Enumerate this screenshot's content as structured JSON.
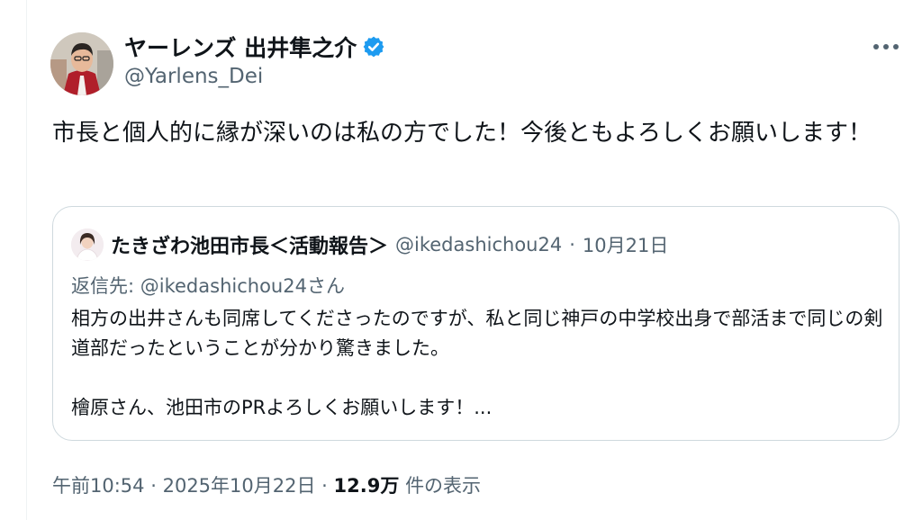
{
  "author": {
    "name": "ヤーレンズ 出井隼之介",
    "handle": "@Yarlens_Dei"
  },
  "tweet": {
    "text": "市長と個人的に縁が深いのは私の方でした！今後ともよろしくお願いします！"
  },
  "quote": {
    "author_name": "たきざわ池田市長＜活動報告＞",
    "handle": "@ikedashichou24",
    "separator": "·",
    "date": "10月21日",
    "reply_prefix": "返信先:",
    "reply_mention": "@ikedashichou24",
    "reply_suffix": "さん",
    "body_line1": "相方の出井さんも同席してくださったのですが、私と同じ神戸の中学校出身で部活まで同じの剣道部だったということが分かり驚きました。",
    "body_line2": "檜原さん、池田市のPRよろしくお願いします！..."
  },
  "footer": {
    "time": "午前10:54",
    "dot": "·",
    "date": "2025年10月22日",
    "views_count": "12.9万",
    "views_label": "件の表示"
  },
  "colors": {
    "verified_blue": "#1d9bf0",
    "secondary_text": "#536471",
    "primary_text": "#0f1419",
    "border": "#cfd9de"
  },
  "icons": {
    "verified": "verified-badge-icon",
    "more": "more-options-icon"
  }
}
